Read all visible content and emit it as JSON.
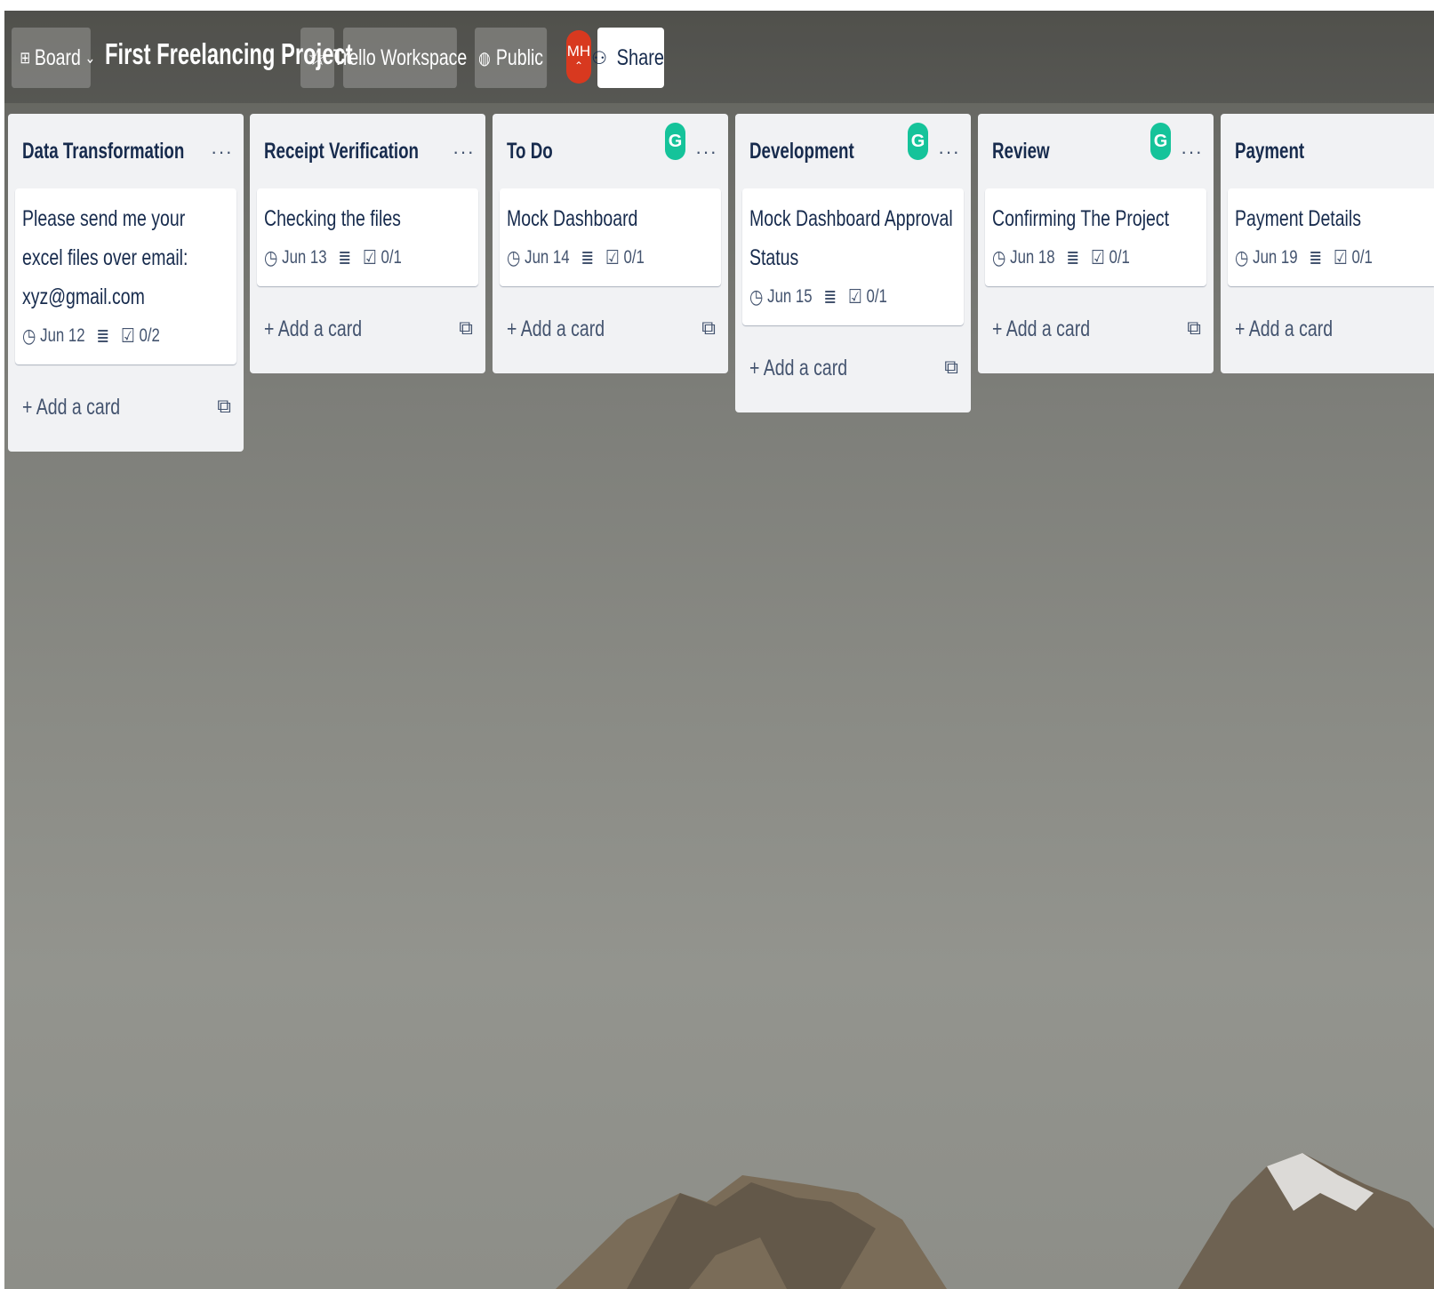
{
  "header": {
    "board_label": "Board",
    "board_title": "First Freelancing Project",
    "workspace_label": "Trello Workspace",
    "visibility_label": "Public",
    "avatar_initials": "MH",
    "share_label": "Share"
  },
  "lists": [
    {
      "title": "Data Transformation",
      "has_grammarly": false,
      "card": {
        "title": "Please send me your excel files over email: xyz@gmail.com",
        "due": "Jun 12",
        "checklist": "0/2"
      },
      "add_label": "Add a card"
    },
    {
      "title": "Receipt Verification",
      "has_grammarly": false,
      "card": {
        "title": "Checking the files",
        "due": "Jun 13",
        "checklist": "0/1"
      },
      "add_label": "Add a card"
    },
    {
      "title": "To Do",
      "has_grammarly": true,
      "card": {
        "title": "Mock Dashboard",
        "due": "Jun 14",
        "checklist": "0/1"
      },
      "add_label": "Add a card"
    },
    {
      "title": "Development",
      "has_grammarly": true,
      "card": {
        "title": "Mock Dashboard Approval Status",
        "due": "Jun 15",
        "checklist": "0/1"
      },
      "add_label": "Add a card"
    },
    {
      "title": "Review",
      "has_grammarly": true,
      "card": {
        "title": "Confirming The Project",
        "due": "Jun 18",
        "checklist": "0/1"
      },
      "add_label": "Add a card"
    },
    {
      "title": "Payment",
      "has_grammarly": false,
      "card": {
        "title": "Payment Details",
        "due": "Jun 19",
        "checklist": "0/1"
      },
      "add_label": "Add a card"
    }
  ],
  "icons": {
    "board": "board-icon",
    "chevron": "chevron-down-icon",
    "star": "star-icon",
    "globe": "globe-icon",
    "share": "add-person-icon",
    "clock": "clock-icon",
    "description": "description-icon",
    "checklist": "checklist-icon",
    "plus": "plus-icon",
    "template": "card-template-icon",
    "grammarly": "grammarly-icon",
    "more": "more-icon"
  },
  "colors": {
    "share_bg": "#ffffff",
    "list_bg": "#f1f2f4",
    "avatar_bg": "#d8391f",
    "grammarly_green": "#15c39a"
  }
}
